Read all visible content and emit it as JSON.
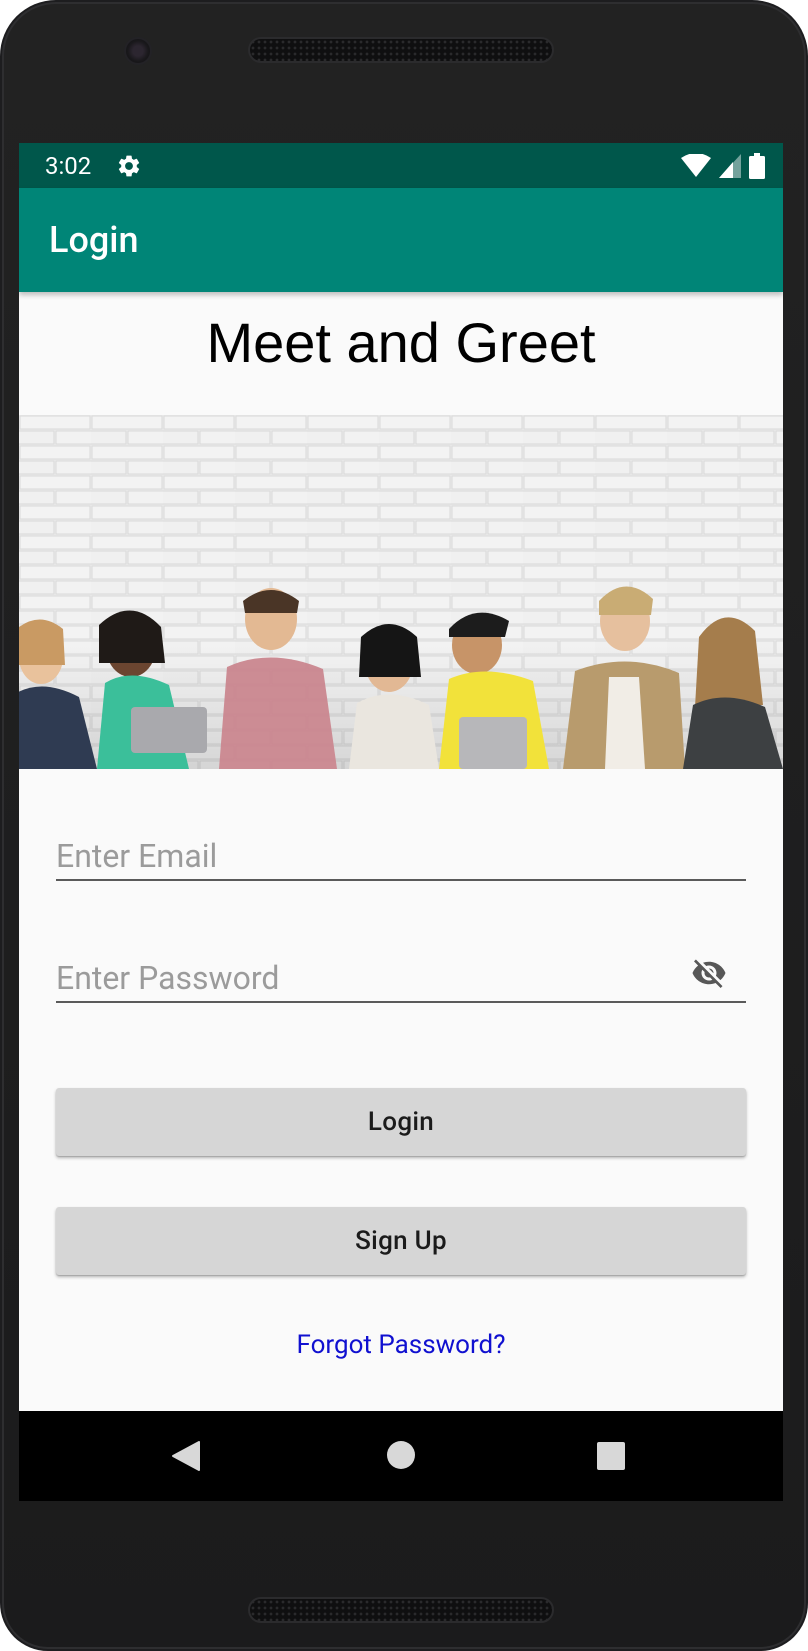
{
  "status_bar": {
    "time": "3:02",
    "icons": [
      "settings-gear-icon",
      "wifi-icon",
      "cell-signal-icon",
      "battery-icon"
    ]
  },
  "app_bar": {
    "title": "Login"
  },
  "content": {
    "heading": "Meet and Greet",
    "hero_image": "group-of-people-sitting-against-white-brick-wall"
  },
  "form": {
    "email": {
      "value": "",
      "placeholder": "Enter Email"
    },
    "password": {
      "value": "",
      "placeholder": "Enter Password",
      "toggle_icon": "visibility-off-icon"
    },
    "login_button": "Login",
    "signup_button": "Sign Up",
    "forgot_link": "Forgot Password?"
  },
  "nav_bar": {
    "icons": [
      "back-triangle-icon",
      "home-circle-icon",
      "recents-square-icon"
    ]
  },
  "colors": {
    "status_bar": "#00574b",
    "app_bar": "#008577",
    "background": "#fafafa",
    "button": "#d6d6d6",
    "link": "#1010d0"
  }
}
